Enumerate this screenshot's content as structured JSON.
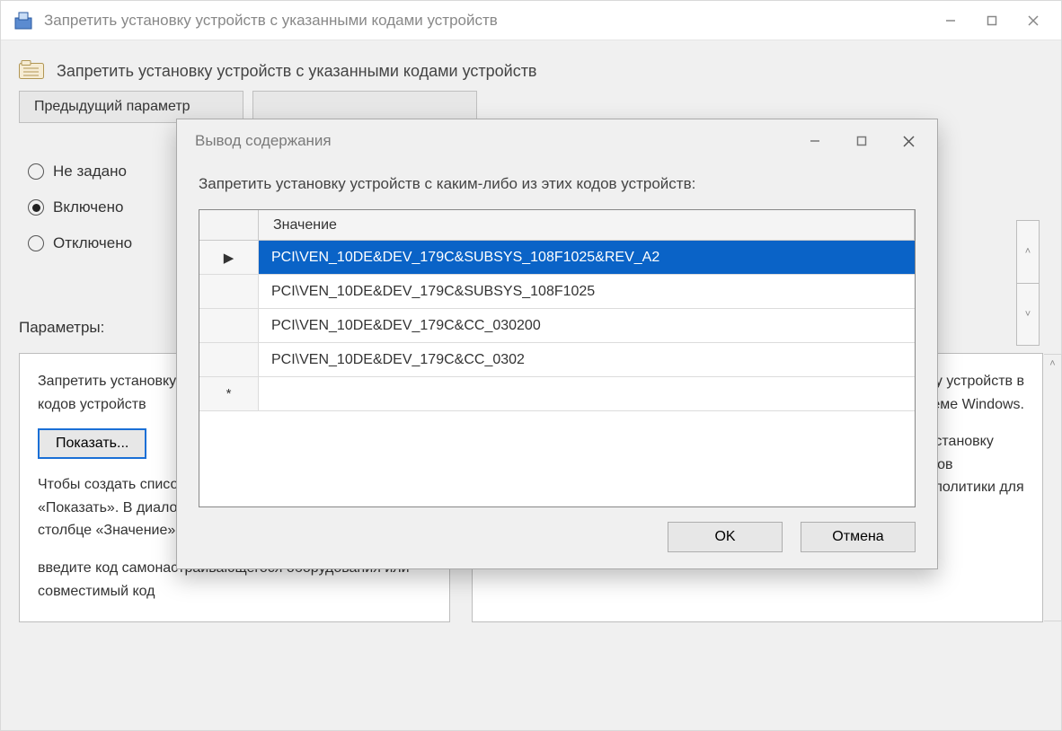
{
  "parent": {
    "window_title": "Запретить установку устройств с указанными кодами устройств",
    "policy_title": "Запретить установку устройств с указанными кодами устройств",
    "prev_button": "Предыдущий параметр",
    "next_button": " ",
    "radios": {
      "not_configured": "Не задано",
      "enabled": "Включено",
      "disabled": "Отключено",
      "selected": "enabled"
    },
    "params_label": "Параметры:",
    "left_pane": {
      "line1": "Запретить установку устройств с какими-либо из этих кодов устройств",
      "show_button": "Показать...",
      "line2": "Чтобы создать список устройств, выберите команду «Показать». В диалоговом окне «Вывод содержания» в столбце «Значение»",
      "line3": "введите код самонастраивающегося оборудования или совместимый код"
    },
    "right_pane": {
      "p1_fragment": "список кодов для Windows. приоритет над этими установку устройств в системе Windows.",
      "p2": "ПРИМЕЧАНИЕ. Чтобы включить параметр политики \"Разрешить установку устройств, соответствующих какому-либо из этих кодов экземпляров устройств\" так, чтобы она имела приоритет над этим параметром политики для"
    }
  },
  "dialog": {
    "title": "Вывод содержания",
    "subtitle": "Запретить установку устройств с каким-либо из этих кодов устройств:",
    "column_header": "Значение",
    "rows": [
      {
        "indicator": "▶",
        "value": "PCI\\VEN_10DE&DEV_179C&SUBSYS_108F1025&REV_A2",
        "selected": true
      },
      {
        "indicator": "",
        "value": "PCI\\VEN_10DE&DEV_179C&SUBSYS_108F1025",
        "selected": false
      },
      {
        "indicator": "",
        "value": "PCI\\VEN_10DE&DEV_179C&CC_030200",
        "selected": false
      },
      {
        "indicator": "",
        "value": "PCI\\VEN_10DE&DEV_179C&CC_0302",
        "selected": false
      },
      {
        "indicator": "*",
        "value": "",
        "selected": false
      }
    ],
    "ok_button": "OK",
    "cancel_button": "Отмена"
  }
}
